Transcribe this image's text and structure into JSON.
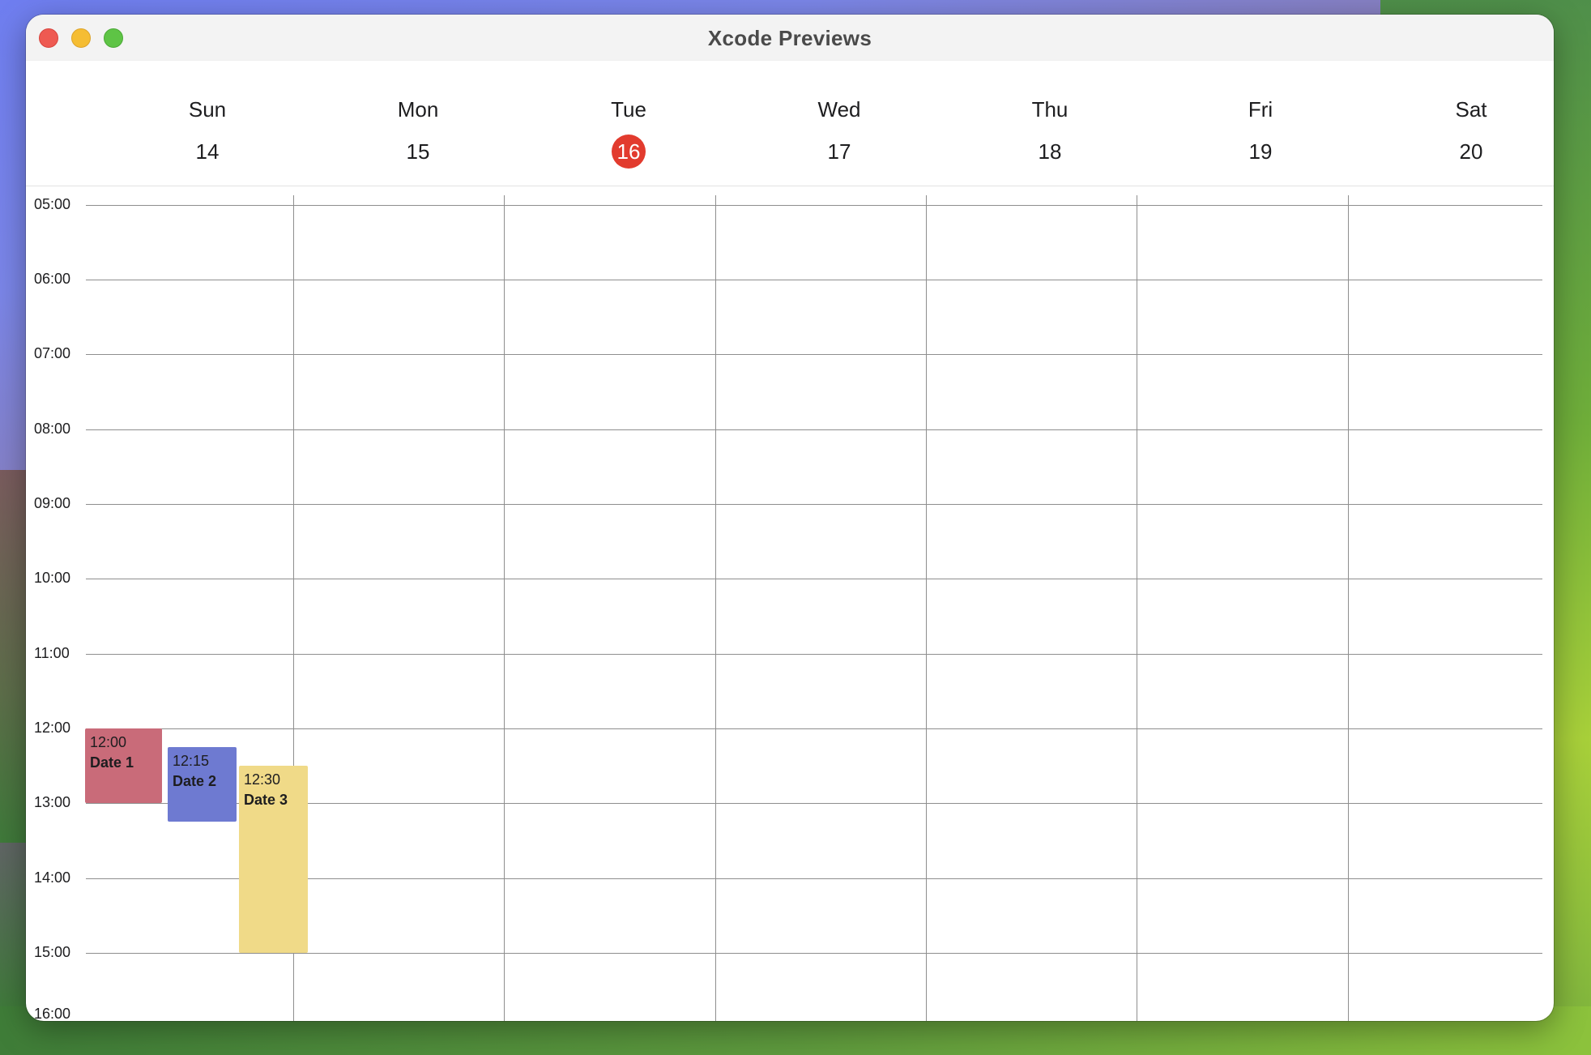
{
  "window": {
    "title": "Xcode Previews"
  },
  "days": [
    {
      "name": "Sun",
      "date": "14",
      "today": false
    },
    {
      "name": "Mon",
      "date": "15",
      "today": false
    },
    {
      "name": "Tue",
      "date": "16",
      "today": true
    },
    {
      "name": "Wed",
      "date": "17",
      "today": false
    },
    {
      "name": "Thu",
      "date": "18",
      "today": false
    },
    {
      "name": "Fri",
      "date": "19",
      "today": false
    },
    {
      "name": "Sat",
      "date": "20",
      "today": false
    }
  ],
  "hours": [
    "05:00",
    "06:00",
    "07:00",
    "08:00",
    "09:00",
    "10:00",
    "11:00",
    "12:00",
    "13:00",
    "14:00",
    "15:00",
    "16:00"
  ],
  "events": [
    {
      "time": "12:00",
      "name": "Date 1",
      "color": "#c96b79"
    },
    {
      "time": "12:15",
      "name": "Date 2",
      "color": "#6e7ad1"
    },
    {
      "time": "12:30",
      "name": "Date 3",
      "color": "#f0da88"
    }
  ],
  "colors": {
    "today_badge": "#e23b2e",
    "grid_line": "#8e8e8e"
  }
}
